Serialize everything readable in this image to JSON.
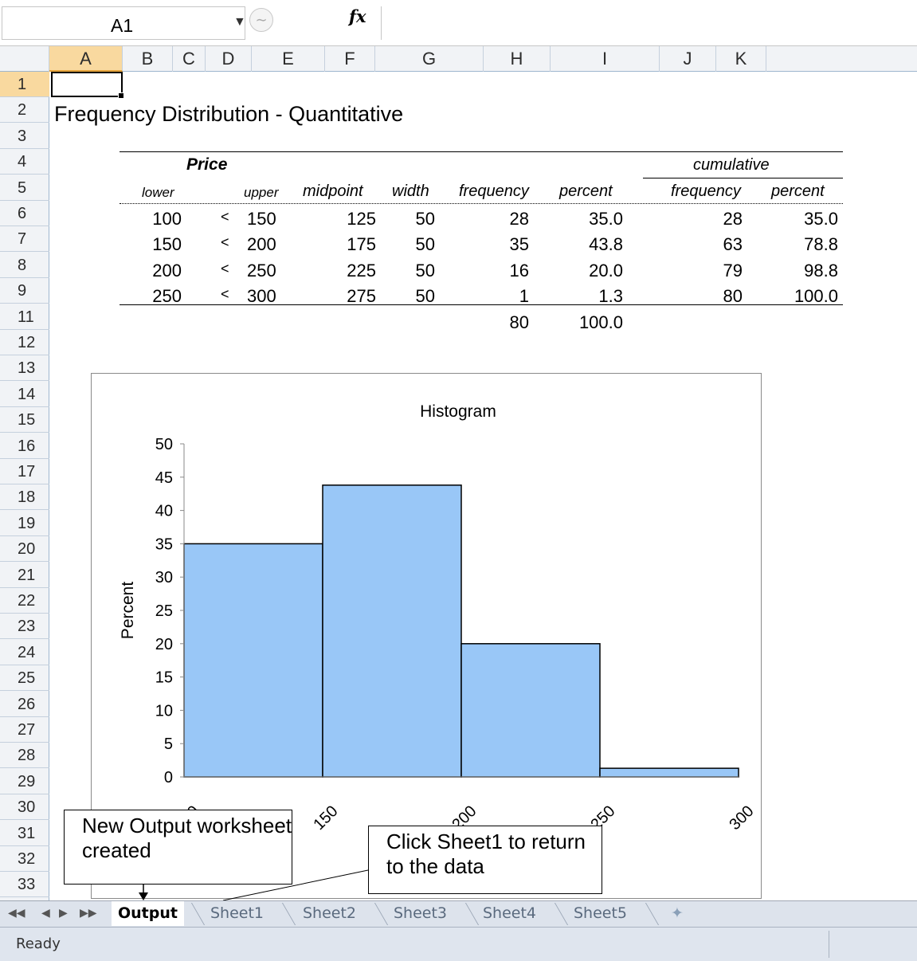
{
  "formula_bar": {
    "name_box": "A1",
    "fx_label": "fx",
    "formula": ""
  },
  "columns": [
    "A",
    "B",
    "C",
    "D",
    "E",
    "F",
    "G",
    "H",
    "I",
    "J",
    "K"
  ],
  "rows": [
    "1",
    "2",
    "3",
    "4",
    "5",
    "6",
    "7",
    "8",
    "9",
    "11",
    "12",
    "13",
    "14",
    "15",
    "16",
    "17",
    "18",
    "19",
    "20",
    "21",
    "22",
    "23",
    "24",
    "25",
    "26",
    "27",
    "28",
    "29",
    "30",
    "31",
    "32",
    "33"
  ],
  "selected_cell": "A1",
  "sheet": {
    "title": "Frequency Distribution - Quantitative",
    "table": {
      "group_price": "Price",
      "group_cumulative": "cumulative",
      "headers": {
        "lower": "lower",
        "upper": "upper",
        "midpoint": "midpoint",
        "width": "width",
        "frequency": "frequency",
        "percent": "percent",
        "cum_frequency": "frequency",
        "cum_percent": "percent"
      },
      "rows": [
        {
          "lower": "100",
          "op": "<",
          "upper": "150",
          "midpoint": "125",
          "width": "50",
          "frequency": "28",
          "percent": "35.0",
          "cum_frequency": "28",
          "cum_percent": "35.0"
        },
        {
          "lower": "150",
          "op": "<",
          "upper": "200",
          "midpoint": "175",
          "width": "50",
          "frequency": "35",
          "percent": "43.8",
          "cum_frequency": "63",
          "cum_percent": "78.8"
        },
        {
          "lower": "200",
          "op": "<",
          "upper": "250",
          "midpoint": "225",
          "width": "50",
          "frequency": "16",
          "percent": "20.0",
          "cum_frequency": "79",
          "cum_percent": "98.8"
        },
        {
          "lower": "250",
          "op": "<",
          "upper": "300",
          "midpoint": "275",
          "width": "50",
          "frequency": "1",
          "percent": "1.3",
          "cum_frequency": "80",
          "cum_percent": "100.0"
        }
      ],
      "totals": {
        "frequency": "80",
        "percent": "100.0"
      }
    }
  },
  "chart_data": {
    "type": "bar",
    "title": "Histogram",
    "ylabel": "Percent",
    "xlabel": "",
    "x_tick_labels": [
      "100",
      "150",
      "200",
      "250",
      "300"
    ],
    "bins": [
      [
        100,
        150
      ],
      [
        150,
        200
      ],
      [
        200,
        250
      ],
      [
        250,
        300
      ]
    ],
    "values": [
      35.0,
      43.8,
      20.0,
      1.3
    ],
    "ylim": [
      0,
      50
    ],
    "y_ticks": [
      0,
      5,
      10,
      15,
      20,
      25,
      30,
      35,
      40,
      45,
      50
    ],
    "bar_color": "#99c7f7",
    "grid": false
  },
  "callouts": {
    "output": "New Output worksheet created",
    "sheet1": "Click Sheet1 to return to the data"
  },
  "sheet_tabs": [
    "Output",
    "Sheet1",
    "Sheet2",
    "Sheet3",
    "Sheet4",
    "Sheet5"
  ],
  "active_tab": "Output",
  "status": "Ready"
}
